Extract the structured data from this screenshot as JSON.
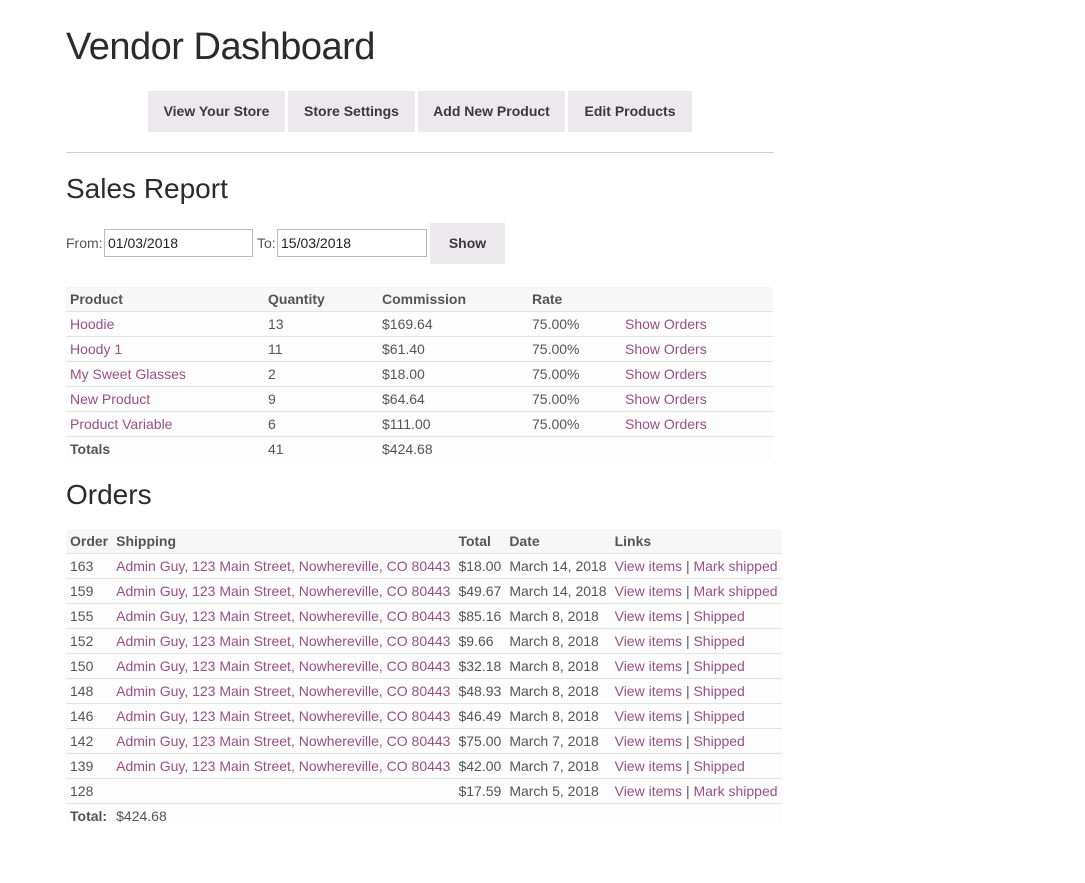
{
  "page": {
    "title": "Vendor Dashboard"
  },
  "nav": [
    "View Your Store",
    "Store Settings",
    "Add New Product",
    "Edit Products"
  ],
  "sales": {
    "heading": "Sales Report",
    "from_label": "From:",
    "from_value": "01/03/2018",
    "to_label": "To:",
    "to_value": "15/03/2018",
    "show_label": "Show",
    "columns": [
      "Product",
      "Quantity",
      "Commission",
      "Rate"
    ],
    "rows": [
      {
        "product": "Hoodie",
        "quantity": "13",
        "commission": "$169.64",
        "rate": "75.00%",
        "link": "Show Orders"
      },
      {
        "product": "Hoody 1",
        "quantity": "11",
        "commission": "$61.40",
        "rate": "75.00%",
        "link": "Show Orders"
      },
      {
        "product": "My Sweet Glasses",
        "quantity": "2",
        "commission": "$18.00",
        "rate": "75.00%",
        "link": "Show Orders"
      },
      {
        "product": "New Product",
        "quantity": "9",
        "commission": "$64.64",
        "rate": "75.00%",
        "link": "Show Orders"
      },
      {
        "product": "Product Variable",
        "quantity": "6",
        "commission": "$111.00",
        "rate": "75.00%",
        "link": "Show Orders"
      }
    ],
    "totals": {
      "label": "Totals",
      "quantity": "41",
      "commission": "$424.68"
    }
  },
  "orders": {
    "heading": "Orders",
    "columns": [
      "Order",
      "Shipping",
      "Total",
      "Date",
      "Links"
    ],
    "rows": [
      {
        "order": "163",
        "shipping": "Admin Guy, 123 Main Street, Nowhereville, CO 80443",
        "total": "$18.00",
        "date": "March 14, 2018",
        "view": "View items",
        "status": "Mark shipped"
      },
      {
        "order": "159",
        "shipping": "Admin Guy, 123 Main Street, Nowhereville, CO 80443",
        "total": "$49.67",
        "date": "March 14, 2018",
        "view": "View items",
        "status": "Mark shipped"
      },
      {
        "order": "155",
        "shipping": "Admin Guy, 123 Main Street, Nowhereville, CO 80443",
        "total": "$85.16",
        "date": "March 8, 2018",
        "view": "View items",
        "status": "Shipped"
      },
      {
        "order": "152",
        "shipping": "Admin Guy, 123 Main Street, Nowhereville, CO 80443",
        "total": "$9.66",
        "date": "March 8, 2018",
        "view": "View items",
        "status": "Shipped"
      },
      {
        "order": "150",
        "shipping": "Admin Guy, 123 Main Street, Nowhereville, CO 80443",
        "total": "$32.18",
        "date": "March 8, 2018",
        "view": "View items",
        "status": "Shipped"
      },
      {
        "order": "148",
        "shipping": "Admin Guy, 123 Main Street, Nowhereville, CO 80443",
        "total": "$48.93",
        "date": "March 8, 2018",
        "view": "View items",
        "status": "Shipped"
      },
      {
        "order": "146",
        "shipping": "Admin Guy, 123 Main Street, Nowhereville, CO 80443",
        "total": "$46.49",
        "date": "March 8, 2018",
        "view": "View items",
        "status": "Shipped"
      },
      {
        "order": "142",
        "shipping": "Admin Guy, 123 Main Street, Nowhereville, CO 80443",
        "total": "$75.00",
        "date": "March 7, 2018",
        "view": "View items",
        "status": "Shipped"
      },
      {
        "order": "139",
        "shipping": "Admin Guy, 123 Main Street, Nowhereville, CO 80443",
        "total": "$42.00",
        "date": "March 7, 2018",
        "view": "View items",
        "status": "Shipped"
      },
      {
        "order": "128",
        "shipping": "",
        "total": "$17.59",
        "date": "March 5, 2018",
        "view": "View items",
        "status": "Mark shipped"
      }
    ],
    "total_label": "Total:",
    "total_value": "$424.68",
    "link_separator": "|"
  },
  "colors": {
    "link": "#9a4f85",
    "button_bg": "#ebe9eb",
    "text": "#555555"
  }
}
